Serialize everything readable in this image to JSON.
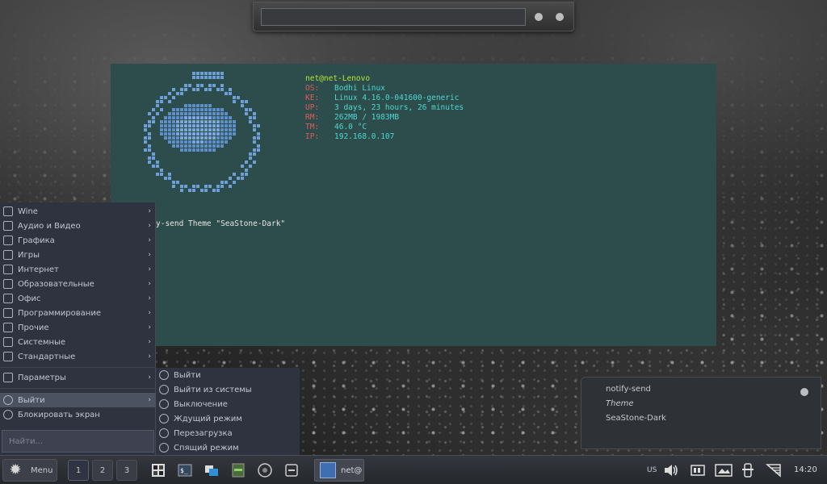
{
  "terminal": {
    "user_host": "net@net-Lenovo",
    "info": [
      {
        "key": "OS:",
        "value": "Bodhi Linux"
      },
      {
        "key": "KE:",
        "value": "Linux 4.16.0-041600-generic"
      },
      {
        "key": "UP:",
        "value": "3 days, 23 hours, 26 minutes"
      },
      {
        "key": "RM:",
        "value": "262MB / 1983MB"
      },
      {
        "key": "TM:",
        "value": "46.0 °C"
      },
      {
        "key": "IP:",
        "value": "192.168.0.107"
      }
    ],
    "command_line": "y-send Theme \"SeaStone-Dark\"",
    "colors": {
      "bg": "#2c4d4b",
      "user": "#b6e63a",
      "key": "#e05a5a",
      "value": "#4fd8d0"
    }
  },
  "menu": {
    "categories": [
      {
        "label": "Wine",
        "icon": "wine-icon"
      },
      {
        "label": "Аудио и Видео",
        "icon": "media-icon"
      },
      {
        "label": "Графика",
        "icon": "graphics-icon"
      },
      {
        "label": "Игры",
        "icon": "games-icon"
      },
      {
        "label": "Интернет",
        "icon": "internet-icon"
      },
      {
        "label": "Образовательные",
        "icon": "education-icon"
      },
      {
        "label": "Офис",
        "icon": "office-icon"
      },
      {
        "label": "Программирование",
        "icon": "programming-icon"
      },
      {
        "label": "Прочие",
        "icon": "other-icon"
      },
      {
        "label": "Системные",
        "icon": "system-icon"
      },
      {
        "label": "Стандартные",
        "icon": "accessories-icon"
      }
    ],
    "settings": "Параметры",
    "logout": "Выйти",
    "lock": "Блокировать экран",
    "search_placeholder": "Найти..."
  },
  "submenu": {
    "items": [
      {
        "label": "Выйти",
        "icon": "exit-icon"
      },
      {
        "label": "Выйти из системы",
        "icon": "logout-icon"
      },
      {
        "label": "Выключение",
        "icon": "power-icon"
      },
      {
        "label": "Ждущий режим",
        "icon": "suspend-icon"
      },
      {
        "label": "Перезагрузка",
        "icon": "reboot-icon"
      },
      {
        "label": "Спящий режим",
        "icon": "hibernate-icon"
      }
    ]
  },
  "notification": {
    "title": "notify-send",
    "summary": "Theme",
    "body": "SeaStone-Dark"
  },
  "taskbar": {
    "start_label": "Menu",
    "workspaces": [
      "1",
      "2",
      "3"
    ],
    "task_label": "net@",
    "keyboard_layout": "US",
    "clock": "14:20"
  }
}
